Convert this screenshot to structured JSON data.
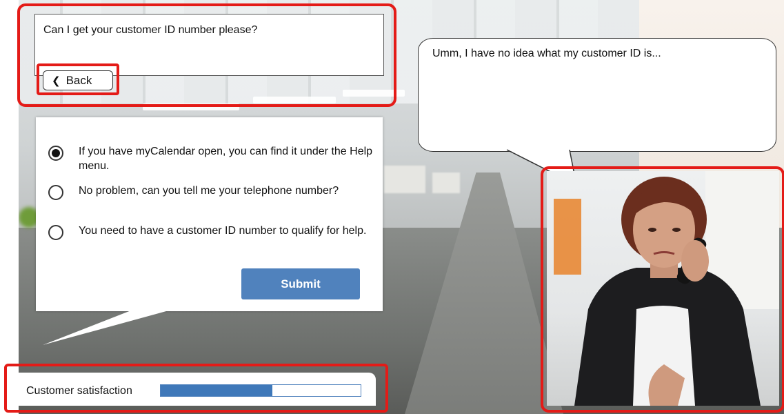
{
  "question": {
    "text": "Can I get your customer ID number please?",
    "back_label": "Back"
  },
  "options": [
    {
      "text": "If you have myCalendar open, you can find it under the Help menu.",
      "selected": true
    },
    {
      "text": "No problem, can you tell me your telephone number?",
      "selected": false
    },
    {
      "text": "You need to have a customer ID number to qualify for help.",
      "selected": false
    }
  ],
  "submit_label": "Submit",
  "customer": {
    "speech": "Umm, I have no idea what my customer ID is..."
  },
  "satisfaction": {
    "label": "Customer satisfaction",
    "level": 0.56
  },
  "colors": {
    "highlight": "#e41b17",
    "accent": "#5082bd",
    "meter_fill": "#3f78b9"
  }
}
